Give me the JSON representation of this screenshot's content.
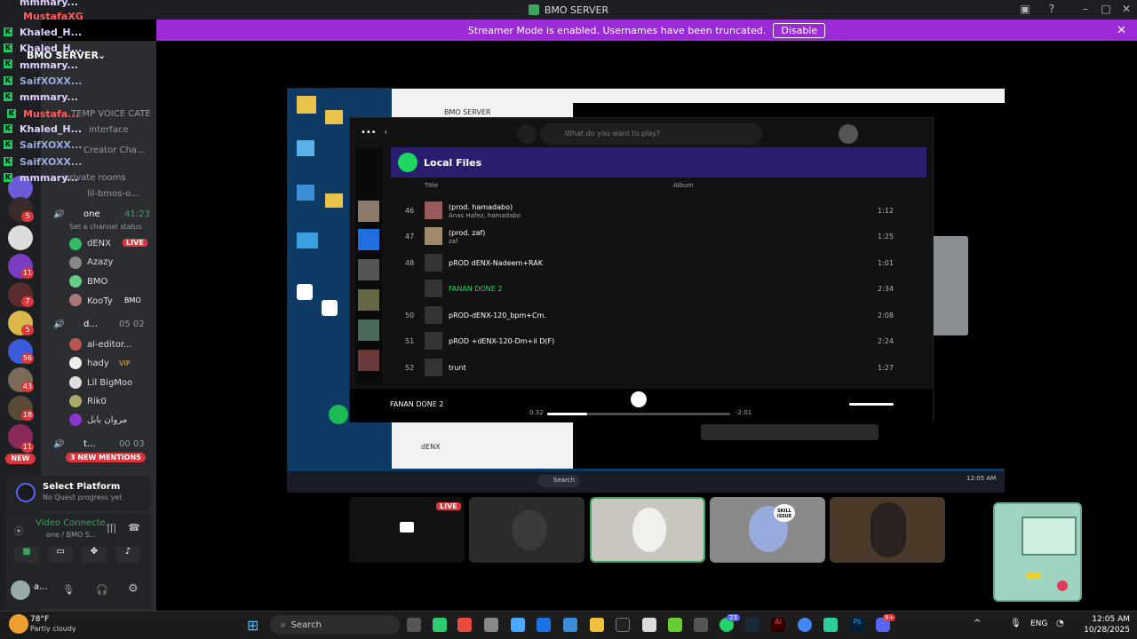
{
  "window": {
    "title": "BMO SERVER"
  },
  "banner": {
    "text": "Streamer Mode is enabled. Usernames have been truncated.",
    "disable_label": "Disable"
  },
  "server": {
    "name": "BMO SERVER"
  },
  "channels": {
    "cat_voice": "TEMP VOICE CATE...",
    "interface": "interface",
    "creator": "Creator Cha...",
    "private_rooms": "private rooms",
    "lil_bmos": "lil-bmos-o...",
    "vc_one": {
      "name": "one",
      "time": "41:23",
      "status": "Set a channel status"
    },
    "vc_d": {
      "name": "d...",
      "a": "05",
      "b": "02"
    },
    "vc_t": {
      "name": "t...",
      "a": "00",
      "b": "03"
    }
  },
  "voice_users": [
    {
      "name": "dENX",
      "tag": "LIVE"
    },
    {
      "name": "Azazy"
    },
    {
      "name": "BMO"
    },
    {
      "name": "KooTy",
      "tag": "BMO"
    }
  ],
  "voice_users2": [
    {
      "name": "al-editor..."
    },
    {
      "name": "hady",
      "tag": "VIP"
    },
    {
      "name": "Lil BigMoo"
    },
    {
      "name": "Rik0"
    },
    {
      "name": "مروان بابل"
    }
  ],
  "overlay_names": [
    "mmmary...",
    "MustafaXG",
    "Khaled_H...",
    "Khaled_H...",
    "mmmary...",
    "SaifXOXX...",
    "mmmary...",
    "Mustafa...",
    "Khaled_H...",
    "SaifXOXX...",
    "SaifXOXX...",
    "mmmary..."
  ],
  "new_mentions": "3 NEW MENTIONS",
  "new_label": "NEW",
  "quest": {
    "title": "Select Platform",
    "sub": "No Quest progress yet"
  },
  "voice": {
    "status": "Video Connecte...",
    "channel": "one / BMO S..."
  },
  "user": {
    "name": "a..."
  },
  "stream": {
    "inner_title": "BMO SERVER",
    "spotify": {
      "search_placeholder": "What do you want to play?",
      "heading": "Local Files",
      "col_title": "Title",
      "col_album": "Album",
      "tracks": [
        {
          "num": "46",
          "name": "(prod. hamadabo)",
          "sub": "Anas Hafez, hamadabo",
          "dur": "1:12"
        },
        {
          "num": "47",
          "name": "(prod. zaf)",
          "sub": "zaf",
          "dur": "1:25"
        },
        {
          "num": "48",
          "name": "pROD dENX-Nadeem+RAK",
          "sub": "",
          "dur": "1:01"
        },
        {
          "num": "",
          "name": "FANAN DONE 2",
          "sub": "",
          "dur": "2:34"
        },
        {
          "num": "50",
          "name": "pROD-dENX-120_bpm+Cm.",
          "sub": "",
          "dur": "2:08"
        },
        {
          "num": "51",
          "name": "pROD +dENX-120-Dm+il D(F)",
          "sub": "",
          "dur": "2:24"
        },
        {
          "num": "52",
          "name": "trunt",
          "sub": "",
          "dur": "1:27"
        }
      ],
      "now_playing": "FANAN DONE 2",
      "elapsed": "0:32",
      "remaining": "-2:01",
      "progress": 0.22
    },
    "user_card": "dENX",
    "taskbar_search": "Search",
    "clock": "12:05 AM"
  },
  "tiles_live": "LIVE",
  "tile_badge": "SKILL ISSUE",
  "weather": {
    "temp": "78°F",
    "desc": "Partly cloudy"
  },
  "taskbar": {
    "search": "Search",
    "lang": "ENG",
    "time": "12:05 AM",
    "date": "10/28/2025",
    "badge_a": "23",
    "badge_b": "9+"
  }
}
